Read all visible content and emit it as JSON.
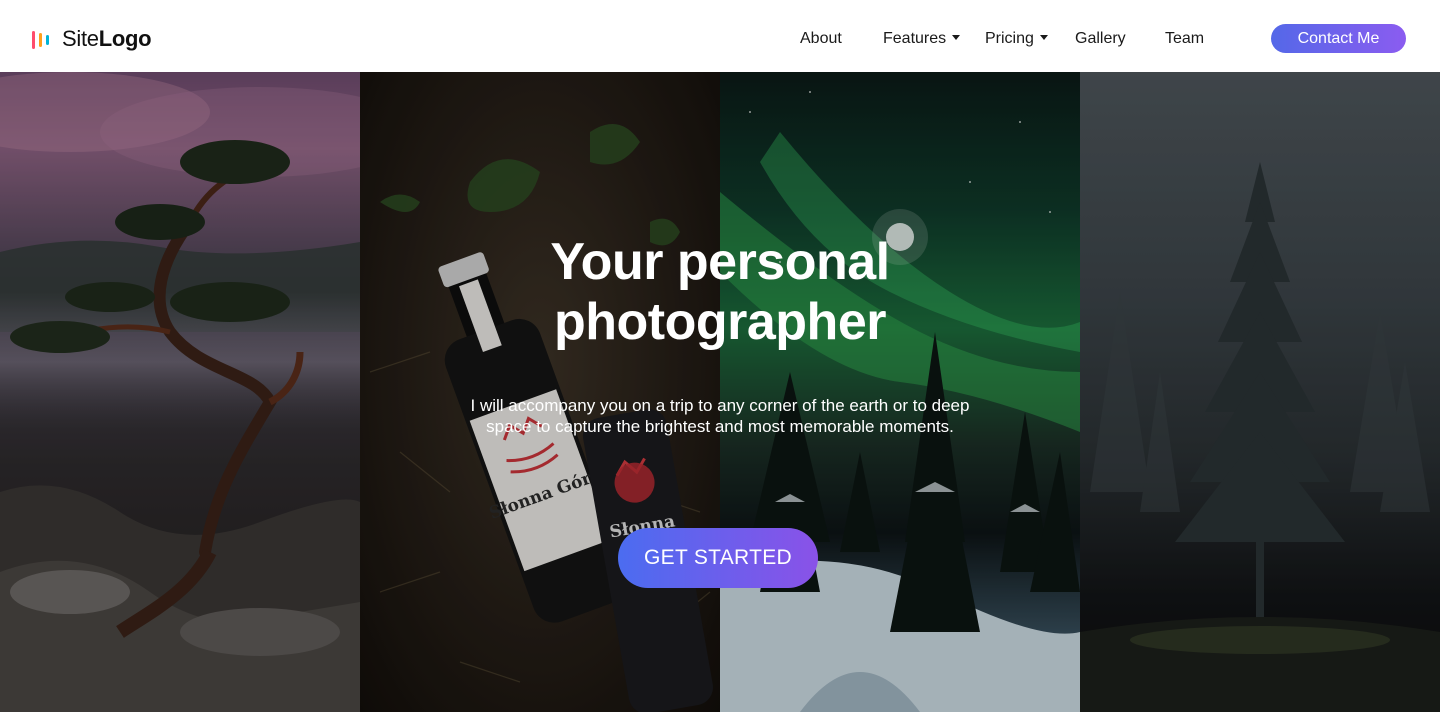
{
  "header": {
    "logo": {
      "part1": "Site",
      "part2": "Logo"
    },
    "nav": [
      {
        "label": "About",
        "has_dropdown": false
      },
      {
        "label": "Features",
        "has_dropdown": true
      },
      {
        "label": "Pricing",
        "has_dropdown": true
      },
      {
        "label": "Gallery",
        "has_dropdown": false
      },
      {
        "label": "Team",
        "has_dropdown": false
      }
    ],
    "cta_label": "Contact Me"
  },
  "hero": {
    "title_line1": "Your personal",
    "title_line2": "photographer",
    "subtitle": "I will accompany you on a trip to any corner of the earth or to deep space to capture the brightest and most memorable moments.",
    "cta_label": "GET STARTED",
    "photo_text": {
      "bottle_label_1": "Słonna Góra",
      "bottle_label_2": "Słonna"
    }
  },
  "colors": {
    "accent_start": "#5468e8",
    "accent_end": "#8b5cf0",
    "header_bg": "#ffffff",
    "nav_text": "#1a1a1a"
  },
  "icons": [
    "logo-bars-icon",
    "chevron-down-icon"
  ]
}
